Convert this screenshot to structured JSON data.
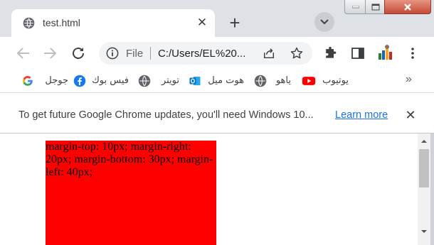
{
  "tab": {
    "title": "test.html",
    "close_glyph": "✕"
  },
  "newtab_glyph": "+",
  "window_controls": {
    "minimize": "minimize",
    "maximize": "maximize",
    "close": "close"
  },
  "toolbar": {
    "omnibox": {
      "scheme_label": "File",
      "url": "C:/Users/EL%20..."
    }
  },
  "bookmarks": {
    "items": [
      {
        "label": "جوجل",
        "icon": "google-icon",
        "color": "#4285f4"
      },
      {
        "label": "فيس بوك",
        "icon": "facebook-icon",
        "color": "#1877f2"
      },
      {
        "label": "تويتر",
        "icon": "globe-icon",
        "color": "#5f6368"
      },
      {
        "label": "هوت ميل",
        "icon": "outlook-icon",
        "color": "#0072c6"
      },
      {
        "label": "ياهو",
        "icon": "globe-icon",
        "color": "#5f6368"
      },
      {
        "label": "يوتيوب",
        "icon": "youtube-icon",
        "color": "#ff0000"
      }
    ],
    "more_glyph": "»"
  },
  "infobar": {
    "message": "To get future Google Chrome updates, you'll need Windows 10...",
    "link": "Learn more",
    "close_glyph": "✕"
  },
  "page": {
    "box_text": "margin-top: 10px; margin-right: 20px; margin-bottom: 30px; margin-left: 40px;",
    "box_color": "#ff0000"
  }
}
